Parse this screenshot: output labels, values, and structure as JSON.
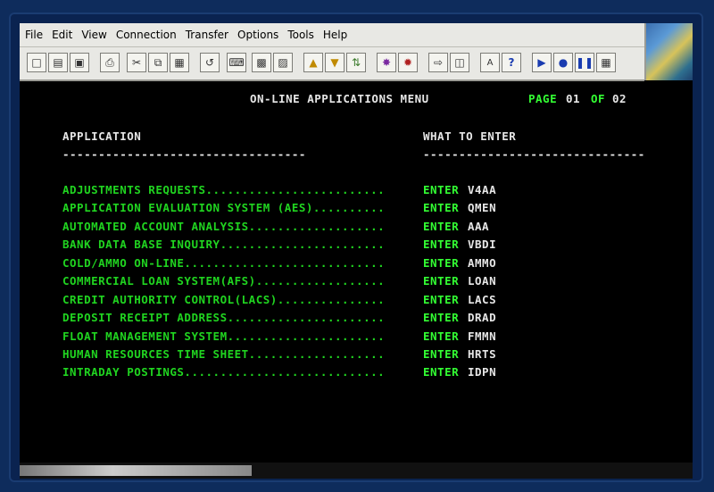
{
  "menu": [
    "File",
    "Edit",
    "View",
    "Connection",
    "Transfer",
    "Options",
    "Tools",
    "Help"
  ],
  "terminal": {
    "title": "ON-LINE APPLICATIONS MENU",
    "page_label": "PAGE",
    "page_current": "01",
    "page_of": "OF",
    "page_total": "02",
    "col_application": "APPLICATION",
    "col_what_to_enter": "WHAT TO ENTER",
    "rule_left": "----------------------------------",
    "rule_right": "-------------------------------",
    "enter_word": "ENTER",
    "rows": [
      {
        "app": "ADJUSTMENTS REQUESTS.........................",
        "code": "V4AA"
      },
      {
        "app": "APPLICATION EVALUATION SYSTEM (AES)..........",
        "code": "QMEN"
      },
      {
        "app": "AUTOMATED ACCOUNT ANALYSIS...................",
        "code": "AAA"
      },
      {
        "app": "BANK DATA BASE INQUIRY.......................",
        "code": "VBDI"
      },
      {
        "app": "COLD/AMMO ON-LINE............................",
        "code": "AMMO"
      },
      {
        "app": "COMMERCIAL LOAN SYSTEM(AFS)..................",
        "code": "LOAN"
      },
      {
        "app": "CREDIT AUTHORITY CONTROL(LACS)...............",
        "code": "LACS"
      },
      {
        "app": "DEPOSIT RECEIPT ADDRESS......................",
        "code": "DRAD"
      },
      {
        "app": "FLOAT MANAGEMENT SYSTEM......................",
        "code": "FMMN"
      },
      {
        "app": "HUMAN RESOURCES TIME SHEET...................",
        "code": "HRTS"
      },
      {
        "app": "INTRADAY POSTINGS............................",
        "code": "IDPN"
      }
    ]
  },
  "icons": [
    "new-icon",
    "open-icon",
    "save-icon",
    "print-icon",
    "cut-icon",
    "copy-icon",
    "paste-icon",
    "undo-icon",
    "keyboard-icon",
    "session-icon",
    "screen-icon",
    "upload-icon",
    "download-icon",
    "transfer-icon",
    "macro-icon",
    "record-icon",
    "host-icon",
    "send-icon",
    "font-icon",
    "help-icon",
    "play-icon",
    "stop-icon",
    "pause-icon",
    "options-icon"
  ]
}
